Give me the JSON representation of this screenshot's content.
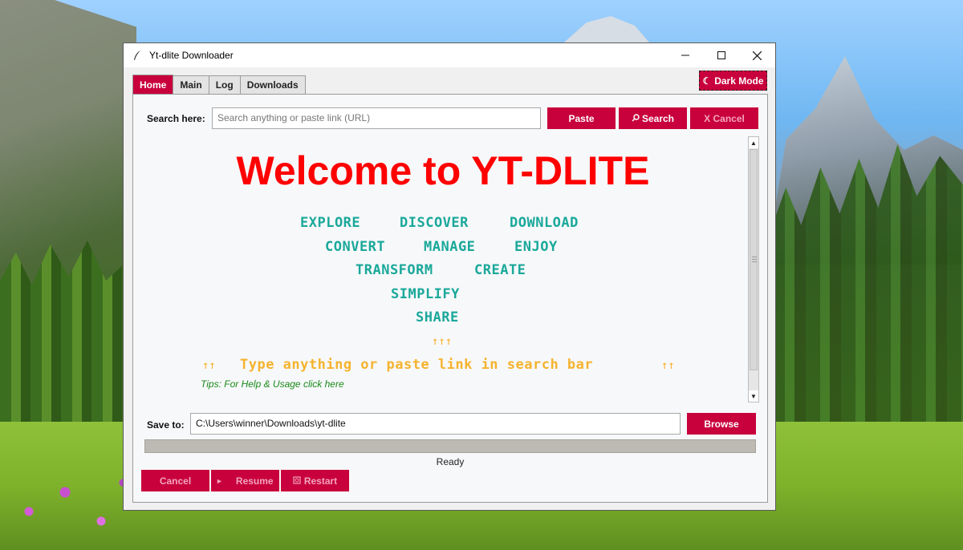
{
  "window": {
    "title": "Yt-dlite Downloader",
    "controls": [
      "minimize",
      "maximize",
      "close"
    ]
  },
  "tabs": [
    {
      "label": "Home",
      "active": true
    },
    {
      "label": "Main",
      "active": false
    },
    {
      "label": "Log",
      "active": false
    },
    {
      "label": "Downloads",
      "active": false
    }
  ],
  "dark_mode_label": "Dark Mode",
  "search": {
    "label": "Search here:",
    "placeholder": "Search anything or paste link (URL)",
    "paste_label": "Paste",
    "search_label": "Search",
    "cancel_label": "X Cancel"
  },
  "welcome": {
    "title": "Welcome to YT-DLITE",
    "keywords": [
      [
        "EXPLORE",
        "DISCOVER",
        "DOWNLOAD"
      ],
      [
        "CONVERT",
        "MANAGE",
        "ENJOY"
      ],
      [
        "TRANSFORM",
        "CREATE"
      ],
      [
        "SIMPLIFY"
      ],
      [
        "SHARE"
      ]
    ],
    "up_arrows": "↑↑↑",
    "hint_left_arrows": "↑↑",
    "hint_text": "Type anything or paste link in search bar",
    "hint_right_arrows": "↑↑",
    "tips": "Tips: For Help & Usage click here"
  },
  "save": {
    "label": "Save to:",
    "path": "C:\\Users\\winner\\Downloads\\yt-dlite",
    "browse_label": "Browse"
  },
  "progress": 0,
  "status": "Ready",
  "actions": {
    "cancel_label": "Cancel",
    "resume_label": "Resume",
    "restart_label": "Restart"
  },
  "colors": {
    "accent": "#c8003c",
    "welcome": "#ff0000",
    "keywords": "#1aa89a",
    "hint": "#f5b32e",
    "tips": "#1a8a1a"
  }
}
